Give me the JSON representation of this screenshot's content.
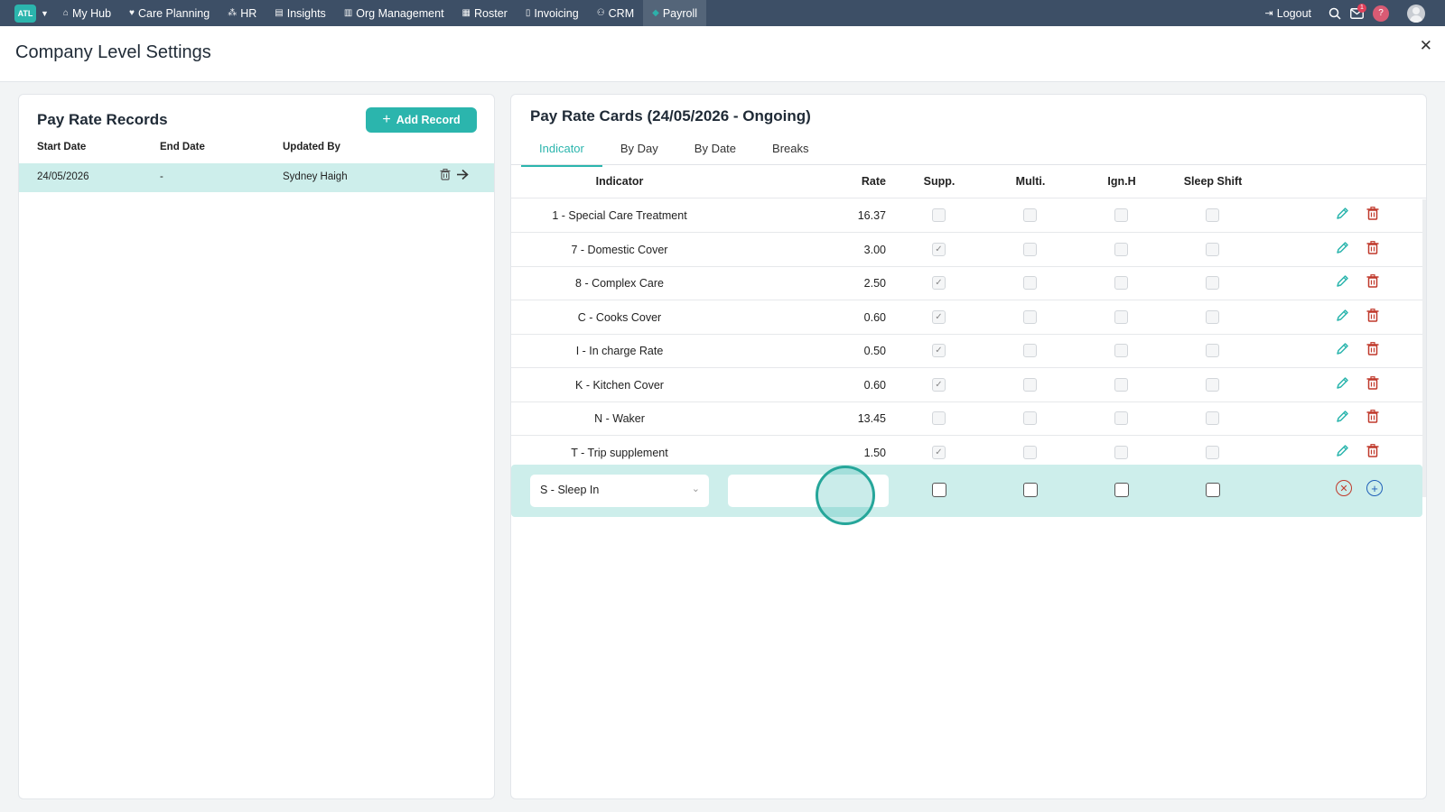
{
  "nav": {
    "brand": "ATL",
    "items": [
      {
        "label": "My Hub",
        "icon": "⌂"
      },
      {
        "label": "Care Planning",
        "icon": "♥"
      },
      {
        "label": "HR",
        "icon": "⁂"
      },
      {
        "label": "Insights",
        "icon": "▤"
      },
      {
        "label": "Org Management",
        "icon": "▥"
      },
      {
        "label": "Roster",
        "icon": "▦"
      },
      {
        "label": "Invoicing",
        "icon": "▯"
      },
      {
        "label": "CRM",
        "icon": "⚇"
      },
      {
        "label": "Payroll",
        "icon": "◆"
      }
    ],
    "logout": "Logout",
    "mail_badge": "1",
    "help": "?"
  },
  "page": {
    "title": "Company Level Settings",
    "close": "✕"
  },
  "records": {
    "title": "Pay Rate Records",
    "add_label": "Add Record",
    "columns": [
      "Start Date",
      "End Date",
      "Updated By"
    ],
    "rows": [
      {
        "start": "24/05/2026",
        "end": "-",
        "updated_by": "Sydney Haigh"
      }
    ]
  },
  "cards": {
    "title": "Pay Rate Cards (24/05/2026 - Ongoing)",
    "tabs": [
      "Indicator",
      "By Day",
      "By Date",
      "Breaks"
    ],
    "columns": [
      "Indicator",
      "Rate",
      "Supp.",
      "Multi.",
      "Ign.H",
      "Sleep Shift"
    ],
    "rows": [
      {
        "indicator": "1 - Special Care Treatment",
        "rate": "16.37",
        "supp": false,
        "multi": false,
        "ignh": false,
        "sleep": false
      },
      {
        "indicator": "7 - Domestic Cover",
        "rate": "3.00",
        "supp": true,
        "multi": false,
        "ignh": false,
        "sleep": false
      },
      {
        "indicator": "8 - Complex Care",
        "rate": "2.50",
        "supp": true,
        "multi": false,
        "ignh": false,
        "sleep": false
      },
      {
        "indicator": "C - Cooks Cover",
        "rate": "0.60",
        "supp": true,
        "multi": false,
        "ignh": false,
        "sleep": false
      },
      {
        "indicator": "I - In charge Rate",
        "rate": "0.50",
        "supp": true,
        "multi": false,
        "ignh": false,
        "sleep": false
      },
      {
        "indicator": "K - Kitchen Cover",
        "rate": "0.60",
        "supp": true,
        "multi": false,
        "ignh": false,
        "sleep": false
      },
      {
        "indicator": "N - Waker",
        "rate": "13.45",
        "supp": false,
        "multi": false,
        "ignh": false,
        "sleep": false
      },
      {
        "indicator": "T - Trip supplement",
        "rate": "1.50",
        "supp": true,
        "multi": false,
        "ignh": false,
        "sleep": false
      }
    ],
    "new_row": {
      "indicator": "S - Sleep In",
      "rate_value": ""
    }
  },
  "colors": {
    "accent": "#2bb5ad",
    "nav_bg": "#3d4f66",
    "delete": "#c0392b",
    "selected_row": "#cdeeeb"
  }
}
